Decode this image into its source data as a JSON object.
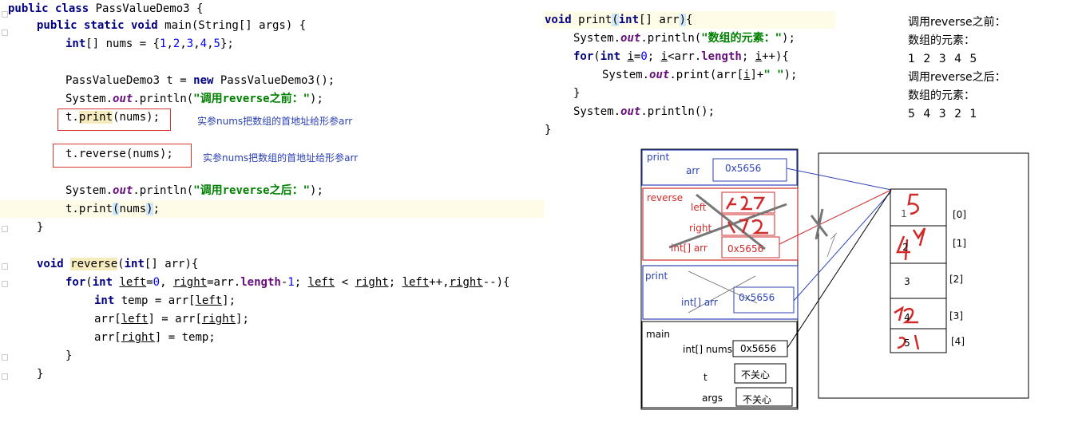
{
  "code_main": {
    "line1": "public class PassValueDemo3 {",
    "line2": "public static void main(String[] args) {",
    "line3": "int[] nums = {1,2,3,4,5};",
    "line4": "PassValueDemo3 t = new PassValueDemo3();",
    "line5_pre": "System.",
    "line5_out": "out",
    "line5_mid": ".println(",
    "line5_str": "\"调用reverse之前：\"",
    "line5_end": ");",
    "line6": "t.print(nums);",
    "line7": "t.reverse(nums);",
    "line8_str": "\"调用reverse之后：\"",
    "line9": "t.print(nums);",
    "brace": "}",
    "line11": "void reverse(int[] arr){",
    "line12": "for(int left=0, right=arr.length-1; left < right; left++,right--){",
    "line13": "int temp = arr[left];",
    "line14": "arr[left] = arr[right];",
    "line15": "arr[right] = temp;"
  },
  "code_print": {
    "line1": "void print(int[] arr){",
    "line2_str": "\"数组的元素：\"",
    "line3": "for(int i=0; i<arr.length; i++){",
    "line4": "System.out.print(arr[i]+\" \");",
    "line5": "System.out.println();"
  },
  "annotations": {
    "note1": "实参nums把数组的首地址给形参arr",
    "note2": "实参nums把数组的首地址给形参arr"
  },
  "console_output": [
    "调用reverse之前：",
    "数组的元素：",
    "1 2 3 4 5",
    "调用reverse之后：",
    "数组的元素：",
    "5 4 3 2 1"
  ],
  "stack": {
    "print_top": {
      "name": "print",
      "arr_label": "arr",
      "arr_value": "0x5656"
    },
    "reverse": {
      "name": "reverse",
      "left_label": "left",
      "right_label": "right",
      "arr_label": "int[]  arr",
      "arr_value": "0x5656"
    },
    "print_mid": {
      "name": "print",
      "arr_label": "int[] arr",
      "arr_value": "0x5656"
    },
    "main": {
      "name": "main",
      "nums_label": "int[] nums",
      "nums_value": "0x5656",
      "t_label": "t",
      "t_value": "不关心",
      "args_label": "args",
      "args_value": "不关心"
    }
  },
  "heap": {
    "cells": [
      "1",
      "2",
      "3",
      "4",
      "5"
    ],
    "indices": [
      "[0]",
      "[1]",
      "[2]",
      "[3]",
      "[4]"
    ]
  },
  "colors": {
    "frame_blue": "#2d43b8",
    "frame_red": "#d12a2a",
    "keyword": "#000080",
    "string": "#008000",
    "highlight_line": "#fefbe6"
  }
}
